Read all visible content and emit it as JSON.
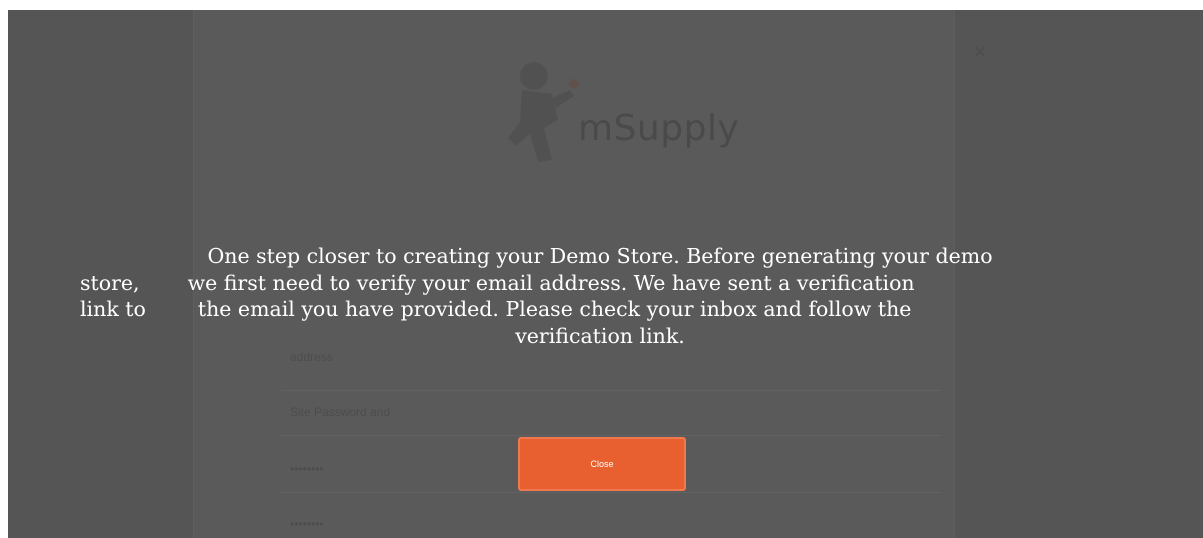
{
  "background": {
    "logo_text": "mSupply",
    "fields": [
      "address",
      "Site Password and",
      "••••••••",
      "••••••••"
    ],
    "close_glyph": "×"
  },
  "dialog": {
    "message_line1": "One step closer to creating your Demo Store. Before generating your demo",
    "message_line2_a": "store,",
    "message_line2_b": "we first need to verify your email address. We have sent a verification",
    "message_line3_a": "link to",
    "message_line3_b": "the email you have provided. Please check your inbox and follow the",
    "message_line4": "verification link.",
    "close_label": "Close"
  },
  "colors": {
    "overlay": "#555555",
    "accent": "#e8602f"
  }
}
